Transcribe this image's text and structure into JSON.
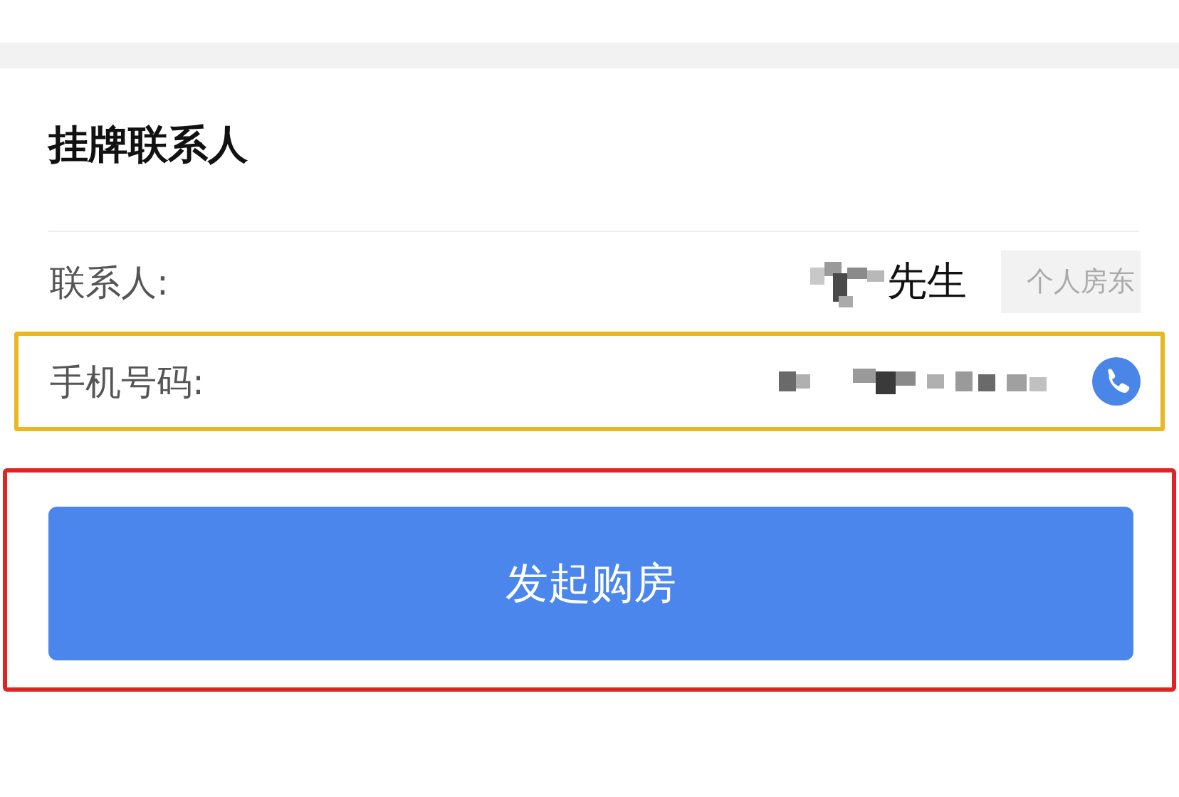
{
  "section_title": "挂牌联系人",
  "fields": [
    {
      "kind": "name",
      "label": "联系人:",
      "value": "先生",
      "tag": "个人房东",
      "highlighted": false
    },
    {
      "kind": "phone",
      "label": "手机号码:",
      "highlighted": true
    }
  ],
  "action_button": {
    "label": "发起购房",
    "highlighted": true
  }
}
